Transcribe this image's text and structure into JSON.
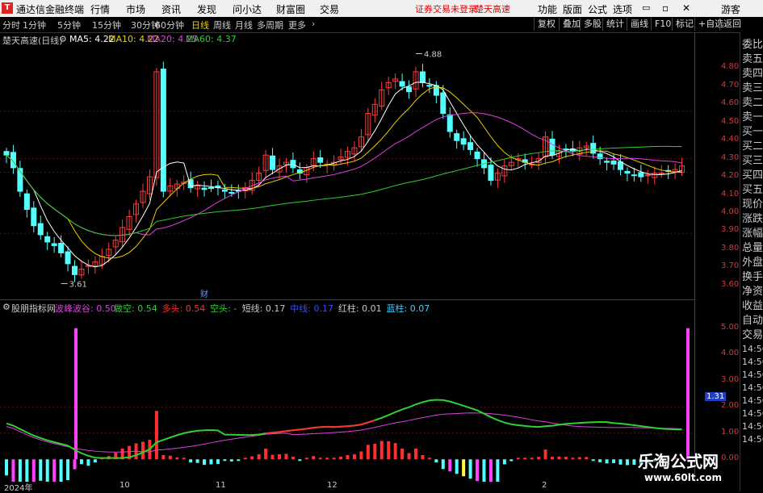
{
  "app": {
    "title": "通达信金融终端",
    "logo": "T"
  },
  "menu": [
    "行情",
    "市场",
    "资讯",
    "发现",
    "问小达",
    "财富圈",
    "交易"
  ],
  "menu_notice": [
    "证券交易未登录",
    "楚天高速"
  ],
  "menu_right": [
    "功能",
    "版面",
    "公式",
    "选项",
    "游客"
  ],
  "periods": [
    "分时",
    "1分钟",
    "5分钟",
    "15分钟",
    "30分钟",
    "60分钟",
    "日线",
    "周线",
    "月线",
    "多周期",
    "更多"
  ],
  "active_period": "日线",
  "toolbar": [
    "复权",
    "叠加",
    "多股",
    "统计",
    "画线",
    "F10",
    "标记",
    "+自选",
    "返回"
  ],
  "main": {
    "stock": "楚天高速(日线)",
    "ma": [
      {
        "label": "MA5: 4.22",
        "color": "#ffffff"
      },
      {
        "label": "MA10: 4.22",
        "color": "#e8d000"
      },
      {
        "label": "MA20: 4.25",
        "color": "#e040e0"
      },
      {
        "label": "MA60: 4.37",
        "color": "#30d030"
      }
    ],
    "high_label": "4.88",
    "low_label": "3.61",
    "cai_label": "财",
    "yaxis": [
      "4.80",
      "4.70",
      "4.60",
      "4.50",
      "4.40",
      "4.30",
      "4.20",
      "4.10",
      "4.00",
      "3.90",
      "3.80",
      "3.70",
      "3.60"
    ]
  },
  "indicator": {
    "name": "股朋指标网",
    "items": [
      {
        "label": "波峰波谷: 0.50",
        "color": "#e040e0"
      },
      {
        "label": "做空: 0.54",
        "color": "#30d030"
      },
      {
        "label": "多头: 0.54",
        "color": "#ff3030"
      },
      {
        "label": "空头: -",
        "color": "#30d030"
      },
      {
        "label": "短线: 0.17",
        "color": "#c8c8c8"
      },
      {
        "label": "中线: 0.17",
        "color": "#3050ff"
      },
      {
        "label": "红柱: 0.01",
        "color": "#c8c8c8"
      },
      {
        "label": "蓝柱: 0.07",
        "color": "#40d0ff"
      }
    ],
    "yaxis": [
      "5.00",
      "4.00",
      "3.00",
      "2.00",
      "1.00",
      "0.00"
    ],
    "current": "1.31"
  },
  "side": [
    "委比",
    "卖五",
    "卖四",
    "卖三",
    "卖二",
    "卖一",
    "买一",
    "买二",
    "买三",
    "买四",
    "买五",
    "现价",
    "涨跌",
    "涨幅",
    "总量",
    "外盘",
    "换手",
    "净资",
    "收益",
    "自动",
    "交易",
    "14:56",
    "14:56",
    "14:56",
    "14:56",
    "14:56",
    "14:56",
    "14:56",
    "14:56"
  ],
  "dates": [
    "2024年",
    "10",
    "11",
    "12",
    "1",
    "2"
  ],
  "watermark": {
    "title": "乐淘公式网",
    "url": "www.60lt.com"
  },
  "chart_data": {
    "type": "candlestick",
    "title": "楚天高速(日线)",
    "ylim": [
      3.55,
      4.9
    ],
    "high": 4.88,
    "low": 3.61,
    "close": [
      4.32,
      4.25,
      4.12,
      4.02,
      3.93,
      3.88,
      3.84,
      3.82,
      3.78,
      3.72,
      3.66,
      3.69,
      3.71,
      3.73,
      3.76,
      3.8,
      3.85,
      3.92,
      3.98,
      4.05,
      4.12,
      4.2,
      4.78,
      4.12,
      4.15,
      4.16,
      4.17,
      4.14,
      4.15,
      4.13,
      4.14,
      4.14,
      4.12,
      4.11,
      4.12,
      4.14,
      4.18,
      4.22,
      4.32,
      4.24,
      4.26,
      4.28,
      4.25,
      4.22,
      4.25,
      4.3,
      4.28,
      4.27,
      4.28,
      4.31,
      4.34,
      4.36,
      4.42,
      4.55,
      4.6,
      4.68,
      4.72,
      4.74,
      4.7,
      4.67,
      4.78,
      4.72,
      4.7,
      4.65,
      4.55,
      4.45,
      4.4,
      4.38,
      4.35,
      4.3,
      4.25,
      4.18,
      4.22,
      4.26,
      4.28,
      4.3,
      4.28,
      4.27,
      4.3,
      4.42,
      4.32,
      4.34,
      4.35,
      4.34,
      4.36,
      4.37,
      4.33,
      4.3,
      4.28,
      4.27,
      4.24,
      4.22,
      4.21,
      4.2,
      4.21,
      4.22,
      4.22,
      4.23,
      4.24,
      4.26
    ]
  }
}
